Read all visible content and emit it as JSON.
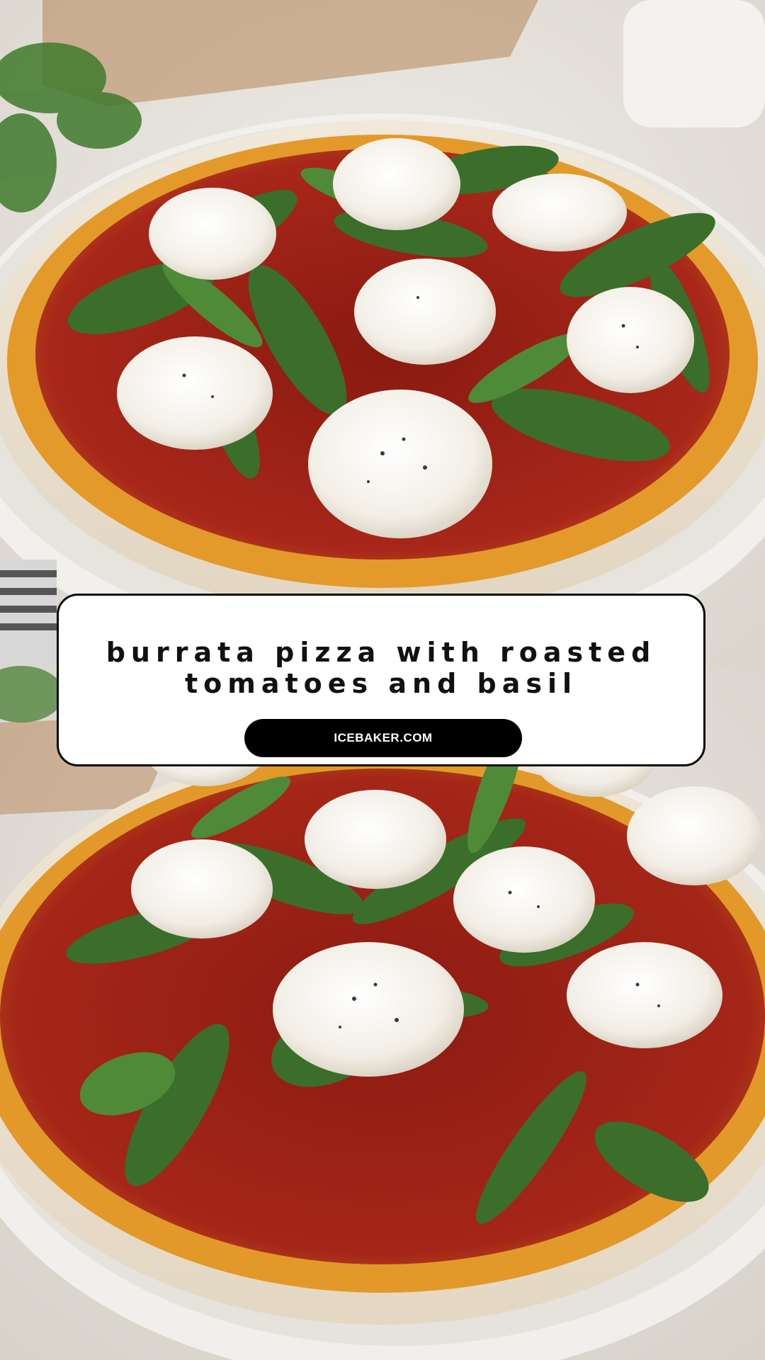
{
  "pin": {
    "title_line_1": "burrata pizza with roasted",
    "title_line_2": "tomatoes and basil",
    "site": "ICEBAKER.COM"
  },
  "photos": {
    "top": {
      "subject": "burrata-pizza",
      "icon": "pizza-photo-icon"
    },
    "bottom": {
      "subject": "burrata-pizza",
      "icon": "pizza-photo-icon"
    }
  },
  "colors": {
    "card_background": "#ffffff",
    "card_border": "#0b0b0b",
    "pill_background": "#000000",
    "pill_text": "#ffffff",
    "title_text": "#111111"
  }
}
